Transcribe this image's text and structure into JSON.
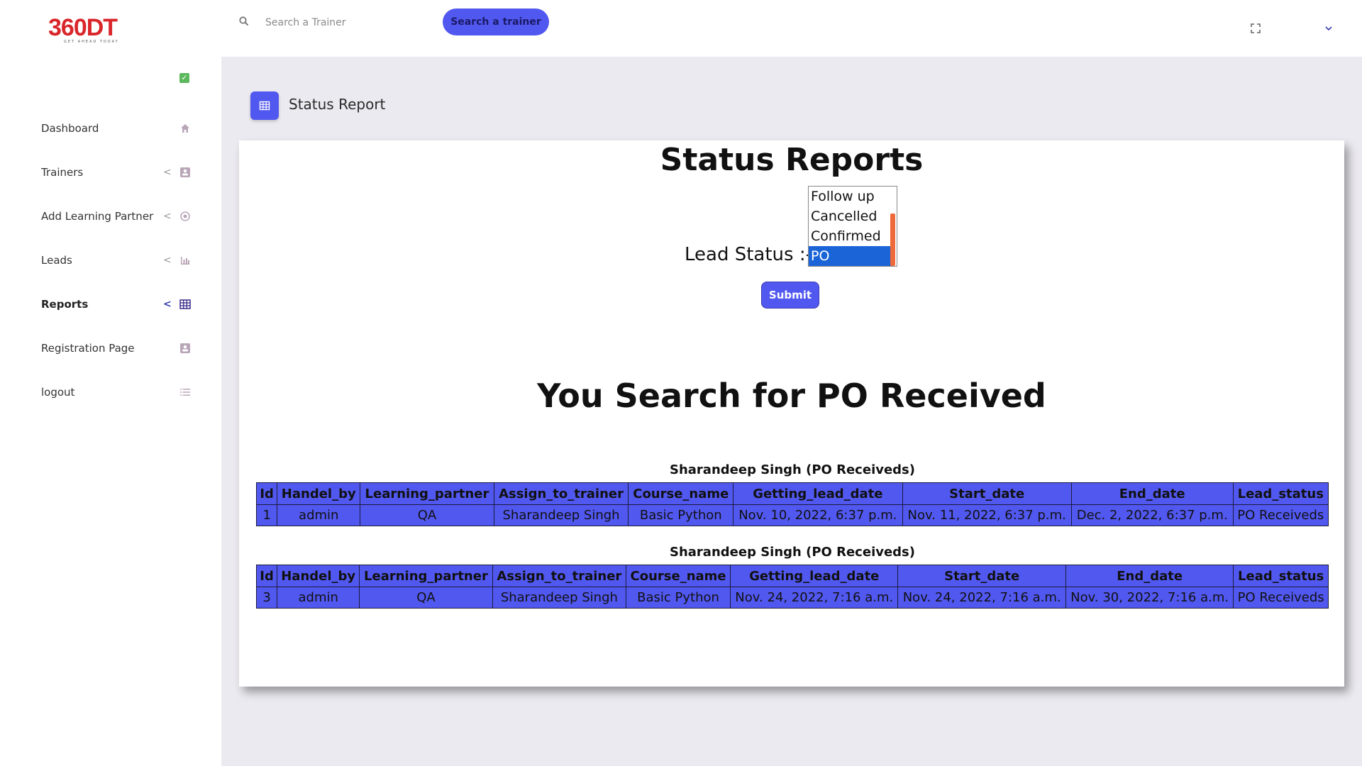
{
  "logo": {
    "text": "360DT",
    "tagline": "GET AHEAD TODAY"
  },
  "sidebar": {
    "items": [
      {
        "label": "Dashboard",
        "icon": "home-icon",
        "chevron": false
      },
      {
        "label": "Trainers",
        "icon": "contact-card-icon",
        "chevron": true
      },
      {
        "label": "Add Learning Partner",
        "icon": "target-icon",
        "chevron": true
      },
      {
        "label": "Leads",
        "icon": "bar-chart-icon",
        "chevron": true
      },
      {
        "label": "Reports",
        "icon": "table-grid-icon",
        "chevron": true,
        "active": true
      },
      {
        "label": "Registration Page",
        "icon": "contact-card-icon",
        "chevron": false
      },
      {
        "label": "logout",
        "icon": "list-icon",
        "chevron": false
      }
    ]
  },
  "topbar": {
    "search_placeholder": "Search a Trainer",
    "search_button": "Search a trainer"
  },
  "page_header": {
    "title": "Status Report"
  },
  "main": {
    "title": "Status Reports",
    "lead_status_label": "Lead Status :-",
    "status_options": [
      "Follow up",
      "Cancelled",
      "Confirmed",
      "PO Received"
    ],
    "selected_status": "PO Received",
    "submit_label": "Submit",
    "result_title": "You Search for PO Received",
    "tables": [
      {
        "caption": "Sharandeep Singh (PO Receiveds)",
        "headers": [
          "Id",
          "Handel_by",
          "Learning_partner",
          "Assign_to_trainer",
          "Course_name",
          "Getting_lead_date",
          "Start_date",
          "End_date",
          "Lead_status"
        ],
        "rows": [
          [
            "1",
            "admin",
            "QA",
            "Sharandeep Singh",
            "Basic Python",
            "Nov. 10, 2022, 6:37 p.m.",
            "Nov. 11, 2022, 6:37 p.m.",
            "Dec. 2, 2022, 6:37 p.m.",
            "PO Receiveds"
          ]
        ]
      },
      {
        "caption": "Sharandeep Singh (PO Receiveds)",
        "headers": [
          "Id",
          "Handel_by",
          "Learning_partner",
          "Assign_to_trainer",
          "Course_name",
          "Getting_lead_date",
          "Start_date",
          "End_date",
          "Lead_status"
        ],
        "rows": [
          [
            "3",
            "admin",
            "QA",
            "Sharandeep Singh",
            "Basic Python",
            "Nov. 24, 2022, 7:16 a.m.",
            "Nov. 24, 2022, 7:16 a.m.",
            "Nov. 30, 2022, 7:16 a.m.",
            "PO Receiveds"
          ]
        ]
      }
    ]
  },
  "colors": {
    "accent": "#5158ef",
    "logo_red": "#d9262b",
    "selected_option": "#1a64d8",
    "scrollbar": "#ef6a3a"
  }
}
